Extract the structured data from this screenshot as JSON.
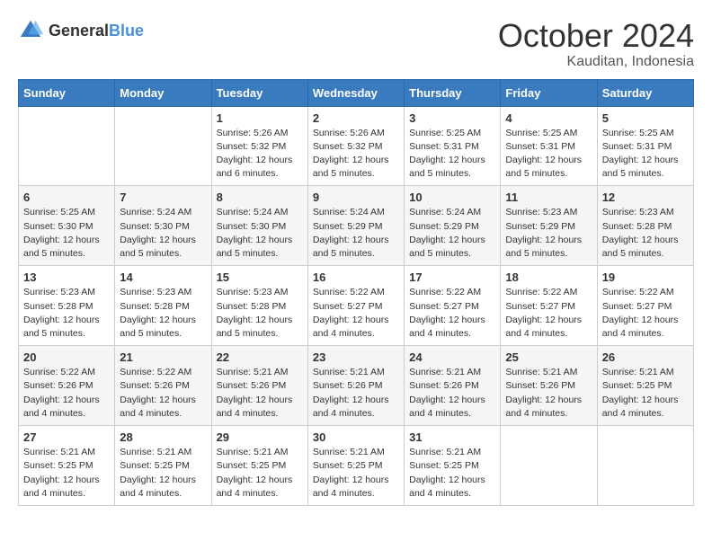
{
  "logo": {
    "general": "General",
    "blue": "Blue"
  },
  "header": {
    "month": "October 2024",
    "location": "Kauditan, Indonesia"
  },
  "weekdays": [
    "Sunday",
    "Monday",
    "Tuesday",
    "Wednesday",
    "Thursday",
    "Friday",
    "Saturday"
  ],
  "weeks": [
    [
      {
        "day": "",
        "sunrise": "",
        "sunset": "",
        "daylight": ""
      },
      {
        "day": "",
        "sunrise": "",
        "sunset": "",
        "daylight": ""
      },
      {
        "day": "1",
        "sunrise": "Sunrise: 5:26 AM",
        "sunset": "Sunset: 5:32 PM",
        "daylight": "Daylight: 12 hours and 6 minutes."
      },
      {
        "day": "2",
        "sunrise": "Sunrise: 5:26 AM",
        "sunset": "Sunset: 5:32 PM",
        "daylight": "Daylight: 12 hours and 5 minutes."
      },
      {
        "day": "3",
        "sunrise": "Sunrise: 5:25 AM",
        "sunset": "Sunset: 5:31 PM",
        "daylight": "Daylight: 12 hours and 5 minutes."
      },
      {
        "day": "4",
        "sunrise": "Sunrise: 5:25 AM",
        "sunset": "Sunset: 5:31 PM",
        "daylight": "Daylight: 12 hours and 5 minutes."
      },
      {
        "day": "5",
        "sunrise": "Sunrise: 5:25 AM",
        "sunset": "Sunset: 5:31 PM",
        "daylight": "Daylight: 12 hours and 5 minutes."
      }
    ],
    [
      {
        "day": "6",
        "sunrise": "Sunrise: 5:25 AM",
        "sunset": "Sunset: 5:30 PM",
        "daylight": "Daylight: 12 hours and 5 minutes."
      },
      {
        "day": "7",
        "sunrise": "Sunrise: 5:24 AM",
        "sunset": "Sunset: 5:30 PM",
        "daylight": "Daylight: 12 hours and 5 minutes."
      },
      {
        "day": "8",
        "sunrise": "Sunrise: 5:24 AM",
        "sunset": "Sunset: 5:30 PM",
        "daylight": "Daylight: 12 hours and 5 minutes."
      },
      {
        "day": "9",
        "sunrise": "Sunrise: 5:24 AM",
        "sunset": "Sunset: 5:29 PM",
        "daylight": "Daylight: 12 hours and 5 minutes."
      },
      {
        "day": "10",
        "sunrise": "Sunrise: 5:24 AM",
        "sunset": "Sunset: 5:29 PM",
        "daylight": "Daylight: 12 hours and 5 minutes."
      },
      {
        "day": "11",
        "sunrise": "Sunrise: 5:23 AM",
        "sunset": "Sunset: 5:29 PM",
        "daylight": "Daylight: 12 hours and 5 minutes."
      },
      {
        "day": "12",
        "sunrise": "Sunrise: 5:23 AM",
        "sunset": "Sunset: 5:28 PM",
        "daylight": "Daylight: 12 hours and 5 minutes."
      }
    ],
    [
      {
        "day": "13",
        "sunrise": "Sunrise: 5:23 AM",
        "sunset": "Sunset: 5:28 PM",
        "daylight": "Daylight: 12 hours and 5 minutes."
      },
      {
        "day": "14",
        "sunrise": "Sunrise: 5:23 AM",
        "sunset": "Sunset: 5:28 PM",
        "daylight": "Daylight: 12 hours and 5 minutes."
      },
      {
        "day": "15",
        "sunrise": "Sunrise: 5:23 AM",
        "sunset": "Sunset: 5:28 PM",
        "daylight": "Daylight: 12 hours and 5 minutes."
      },
      {
        "day": "16",
        "sunrise": "Sunrise: 5:22 AM",
        "sunset": "Sunset: 5:27 PM",
        "daylight": "Daylight: 12 hours and 4 minutes."
      },
      {
        "day": "17",
        "sunrise": "Sunrise: 5:22 AM",
        "sunset": "Sunset: 5:27 PM",
        "daylight": "Daylight: 12 hours and 4 minutes."
      },
      {
        "day": "18",
        "sunrise": "Sunrise: 5:22 AM",
        "sunset": "Sunset: 5:27 PM",
        "daylight": "Daylight: 12 hours and 4 minutes."
      },
      {
        "day": "19",
        "sunrise": "Sunrise: 5:22 AM",
        "sunset": "Sunset: 5:27 PM",
        "daylight": "Daylight: 12 hours and 4 minutes."
      }
    ],
    [
      {
        "day": "20",
        "sunrise": "Sunrise: 5:22 AM",
        "sunset": "Sunset: 5:26 PM",
        "daylight": "Daylight: 12 hours and 4 minutes."
      },
      {
        "day": "21",
        "sunrise": "Sunrise: 5:22 AM",
        "sunset": "Sunset: 5:26 PM",
        "daylight": "Daylight: 12 hours and 4 minutes."
      },
      {
        "day": "22",
        "sunrise": "Sunrise: 5:21 AM",
        "sunset": "Sunset: 5:26 PM",
        "daylight": "Daylight: 12 hours and 4 minutes."
      },
      {
        "day": "23",
        "sunrise": "Sunrise: 5:21 AM",
        "sunset": "Sunset: 5:26 PM",
        "daylight": "Daylight: 12 hours and 4 minutes."
      },
      {
        "day": "24",
        "sunrise": "Sunrise: 5:21 AM",
        "sunset": "Sunset: 5:26 PM",
        "daylight": "Daylight: 12 hours and 4 minutes."
      },
      {
        "day": "25",
        "sunrise": "Sunrise: 5:21 AM",
        "sunset": "Sunset: 5:26 PM",
        "daylight": "Daylight: 12 hours and 4 minutes."
      },
      {
        "day": "26",
        "sunrise": "Sunrise: 5:21 AM",
        "sunset": "Sunset: 5:25 PM",
        "daylight": "Daylight: 12 hours and 4 minutes."
      }
    ],
    [
      {
        "day": "27",
        "sunrise": "Sunrise: 5:21 AM",
        "sunset": "Sunset: 5:25 PM",
        "daylight": "Daylight: 12 hours and 4 minutes."
      },
      {
        "day": "28",
        "sunrise": "Sunrise: 5:21 AM",
        "sunset": "Sunset: 5:25 PM",
        "daylight": "Daylight: 12 hours and 4 minutes."
      },
      {
        "day": "29",
        "sunrise": "Sunrise: 5:21 AM",
        "sunset": "Sunset: 5:25 PM",
        "daylight": "Daylight: 12 hours and 4 minutes."
      },
      {
        "day": "30",
        "sunrise": "Sunrise: 5:21 AM",
        "sunset": "Sunset: 5:25 PM",
        "daylight": "Daylight: 12 hours and 4 minutes."
      },
      {
        "day": "31",
        "sunrise": "Sunrise: 5:21 AM",
        "sunset": "Sunset: 5:25 PM",
        "daylight": "Daylight: 12 hours and 4 minutes."
      },
      {
        "day": "",
        "sunrise": "",
        "sunset": "",
        "daylight": ""
      },
      {
        "day": "",
        "sunrise": "",
        "sunset": "",
        "daylight": ""
      }
    ]
  ]
}
